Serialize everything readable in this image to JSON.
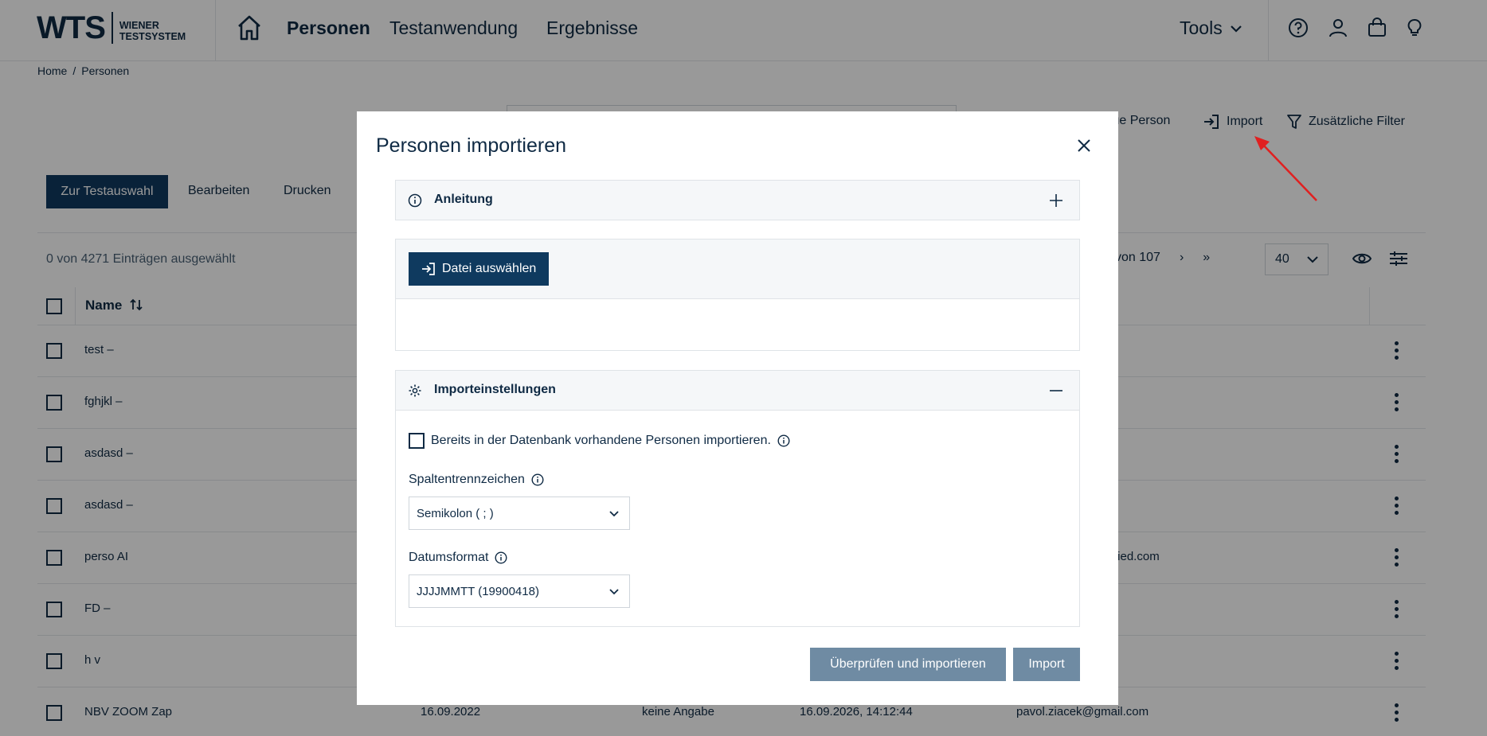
{
  "header": {
    "logo_big": "WTS",
    "logo_line1": "WIENER",
    "logo_line2": "TESTSYSTEM",
    "nav": [
      "Personen",
      "Testanwendung",
      "Ergebnisse"
    ],
    "tools_label": "Tools"
  },
  "breadcrumb": {
    "home": "Home",
    "separator": "/",
    "current": "Personen"
  },
  "page": {
    "toolbar": {
      "new_person": "Neue Person",
      "import": "Import",
      "filter": "Zusätzliche Filter"
    },
    "actions": {
      "to_test": "Zur Testauswahl",
      "edit": "Bearbeiten",
      "print": "Drucken"
    },
    "selection_info": "0 von 4271 Einträgen ausgewählt",
    "pager": {
      "pages": "von 107",
      "next": "›",
      "last": "»"
    },
    "page_size": "40",
    "table": {
      "name_header": "Name",
      "rows": [
        {
          "name": "test –"
        },
        {
          "name": "fghjkl –"
        },
        {
          "name": "asdasd –"
        },
        {
          "name": "asdasd –"
        },
        {
          "name": "perso AI",
          "email": "fried.com"
        },
        {
          "name": "FD –"
        },
        {
          "name": "h v"
        },
        {
          "name": "NBV ZOOM Zap",
          "date": "16.09.2022",
          "gender": "keine Angabe",
          "valid_until": "16.09.2026, 14:12:44",
          "email": "pavol.ziacek@gmail.com"
        }
      ]
    }
  },
  "modal": {
    "title": "Personen importieren",
    "instructions_title": "Anleitung",
    "file_button": "Datei auswählen",
    "settings_title": "Importeinstellungen",
    "import_existing_label": "Bereits in der Datenbank vorhandene Personen importieren.",
    "import_existing_checked": false,
    "separator_label": "Spaltentrennzeichen",
    "separator_value": "Semikolon ( ; )",
    "date_format_label": "Datumsformat",
    "date_format_value": "JJJJMMTT (19900418)",
    "check_import_button": "Überprüfen und importieren",
    "import_button": "Import"
  },
  "colors": {
    "primary": "#0f3a5f",
    "disabled_button": "#6f8ba3",
    "annotation_arrow": "#e02020"
  }
}
